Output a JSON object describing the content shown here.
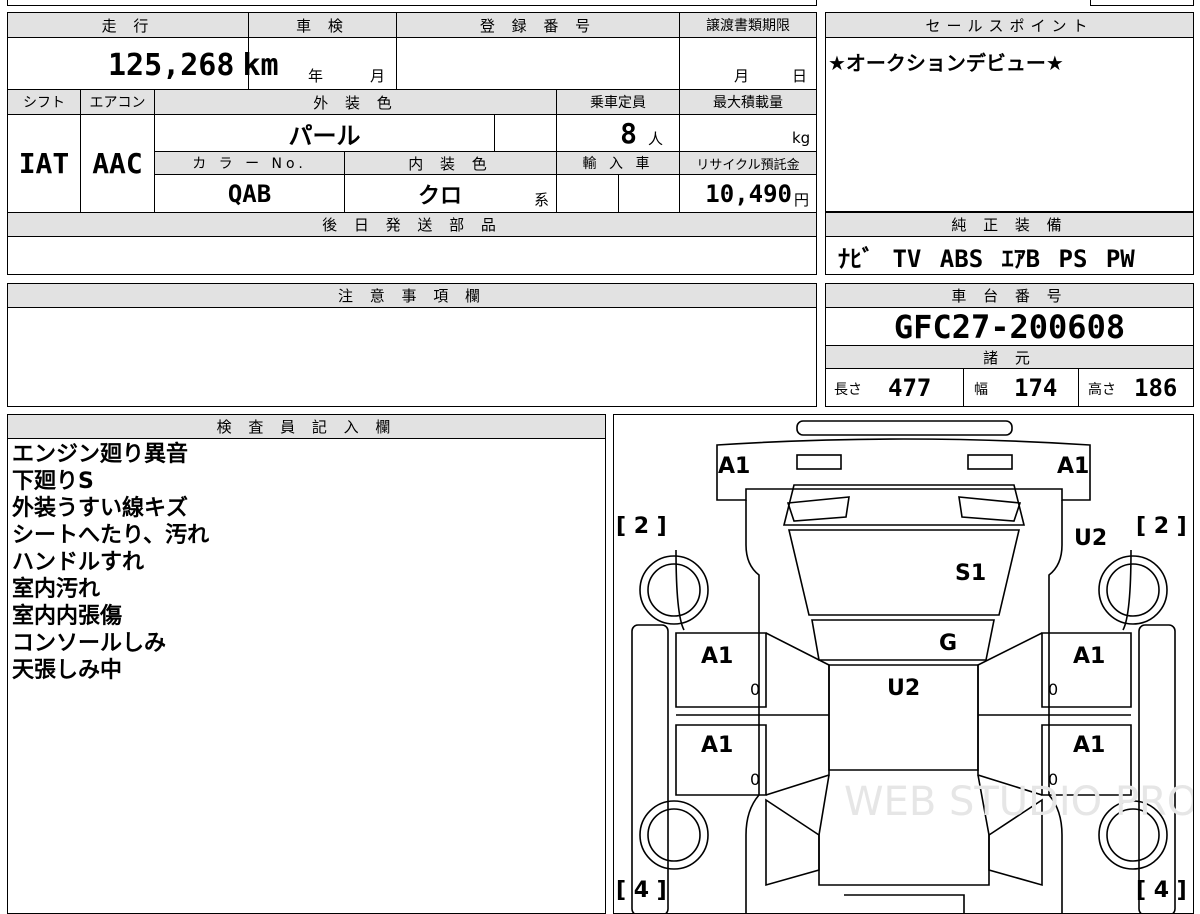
{
  "vehicle": {
    "mileage_label": "走 行",
    "mileage_value": "125,268",
    "mileage_unit": "km",
    "inspection_label": "車 検",
    "inspection_year": "年",
    "inspection_month": "月",
    "registration_label": "登 録 番 号",
    "transfer_label": "譲渡書類期限",
    "transfer_month": "月",
    "transfer_day": "日",
    "shift_label": "シフト",
    "shift_value": "IAT",
    "aircon_label": "エアコン",
    "aircon_value": "AAC",
    "exterior_label": "外 装 色",
    "exterior_value": "パール",
    "capacity_label": "乗車定員",
    "capacity_value": "8",
    "capacity_unit": "人",
    "maxload_label": "最大積載量",
    "maxload_unit": "kg",
    "colorno_label": "カ ラ ー No.",
    "colorno_value": "QAB",
    "interior_label": "内 装 色",
    "interior_value": "クロ",
    "interior_unit": "系",
    "import_label": "輸 入 車",
    "recycle_label": "リサイクル預託金",
    "recycle_value": "10,490",
    "recycle_unit": "円",
    "later_parts_label": "後 日 発 送 部 品"
  },
  "sales_point": {
    "label": "セールスポイント",
    "text": "★オークションデビュー★"
  },
  "equipment": {
    "label": "純 正 装 備",
    "items": "ﾅﾋﾞ TV ABS ｴｱB PS PW"
  },
  "chassis": {
    "label": "車 台 番 号",
    "number": "GFC27-200608"
  },
  "specs": {
    "label": "諸 元",
    "length_label": "長さ",
    "length_value": "477",
    "width_label": "幅",
    "width_value": "174",
    "height_label": "高さ",
    "height_value": "186"
  },
  "caution": {
    "label": "注 意 事 項 欄"
  },
  "inspector": {
    "label": "検 査 員 記 入 欄",
    "notes": [
      "エンジン廻り異音",
      "下廻りS",
      "外装うすい線キズ",
      "シートへたり、汚れ",
      "ハンドルすれ",
      "室内汚れ",
      "室内内張傷",
      "コンソールしみ",
      "天張しみ中"
    ]
  },
  "diagram": {
    "marks": {
      "front_left": "A1",
      "front_right": "A1",
      "left_front": "U2",
      "seat": "S1",
      "rear_glass": "G",
      "floor": "U2",
      "door_fl": "A1",
      "door_fr": "A1",
      "door_rl": "A1",
      "door_rr": "A1",
      "door_fl_num": "0",
      "door_fr_num": "0",
      "door_rl_num": "0",
      "door_rr_num": "0",
      "tire_tl": "[ 2 ]",
      "tire_tr": "[ 2 ]",
      "tire_bl": "[ 4 ]",
      "tire_br": "[ 4 ]"
    },
    "watermark": "WEB STUDIO PRO"
  }
}
